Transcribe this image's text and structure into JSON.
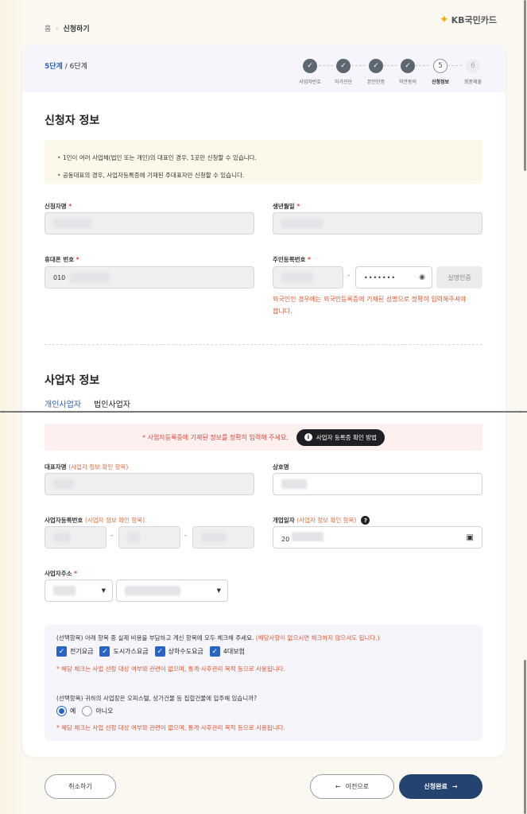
{
  "breadcrumb": {
    "home": "홈",
    "current": "신청하기"
  },
  "logo": {
    "text": "KB국민카드",
    "symbol": "✦"
  },
  "progress": {
    "current": "5단계",
    "total": "/ 6단계"
  },
  "steps": [
    {
      "num": "✓",
      "label": "사업자번호",
      "state": "done"
    },
    {
      "num": "✓",
      "label": "자가진단",
      "state": "done"
    },
    {
      "num": "✓",
      "label": "본인인증",
      "state": "done"
    },
    {
      "num": "✓",
      "label": "약관동의",
      "state": "done"
    },
    {
      "num": "5",
      "label": "신청정보",
      "state": "active"
    },
    {
      "num": "6",
      "label": "최종제출",
      "state": "todo"
    }
  ],
  "applicant": {
    "title": "신청자 정보",
    "notices": [
      "1인이 여러 사업체(법인 또는 개인)의 대표인 경우, 1곳만 신청할 수 있습니다.",
      "공동대표의 경우, 사업자등록증에 기재된 주대표자만 신청할 수 있습니다."
    ],
    "name_label": "신청자명",
    "birth_label": "생년월일",
    "phone_label": "휴대폰 번호",
    "phone_value": "010",
    "rrn_label": "주민등록번호",
    "rrn_dash": "-",
    "rrn_masked": "•••••••",
    "verify_button": "실명인증",
    "foreigner_notice": "외국인인 경우에는 외국인등록증에 기재된 성명으로 정확히 입력해주셔야 합니다.",
    "required_mark": "*"
  },
  "business": {
    "title": "사업자 정보",
    "tabs": [
      "개인사업자",
      "법인사업자"
    ],
    "banner_text": "* 사업자등록증에 기재된 정보를 정확히 입력해 주세요.",
    "banner_button": "사업자 등록증 확인 방법",
    "rep_label": "대표자명",
    "rep_hint": "(사업자 정보 확인 항목)",
    "trade_label": "상호명",
    "regno_label": "사업자등록번호",
    "regno_hint": "(사업자 정보 확인 항목)",
    "open_label": "개업일자",
    "open_hint": "(사업자 정보 확인 항목)",
    "open_value": "20",
    "addr_label": "사업자주소",
    "required_mark": "*",
    "dash": "-"
  },
  "options": {
    "q1_title": "(선택항목) 아래 항목 중 실제 비용을 부담하고 계신 항목에 모두 체크해 주세요.",
    "q1_note": "(해당사항이 없으시면 체크하지 않으셔도 됩니다.)",
    "checks": [
      "전기요금",
      "도시가스요금",
      "상하수도요금",
      "4대보험"
    ],
    "q1_red": "* 해당 체크는 사업 선정 대상 여부와 관련이 없으며, 통계·사후관리 목적 등으로 사용됩니다.",
    "q2_title": "(선택항목) 귀하의 사업장은 오피스텔, 상가건물 등 집합건물에 입주해 있습니까?",
    "radio_yes": "예",
    "radio_no": "아니오",
    "q2_red": "* 해당 체크는 사업 선정 대상 여부와 관련이 없으며, 통계·사후관리 목적 등으로 사용됩니다."
  },
  "footer": {
    "cancel": "취소하기",
    "prev": "이전으로",
    "submit": "신청완료",
    "prev_arrow": "←",
    "next_arrow": "→"
  },
  "colors": {
    "accent": "#2863c6",
    "primary_button": "#24436e",
    "warn": "#e2552f"
  }
}
